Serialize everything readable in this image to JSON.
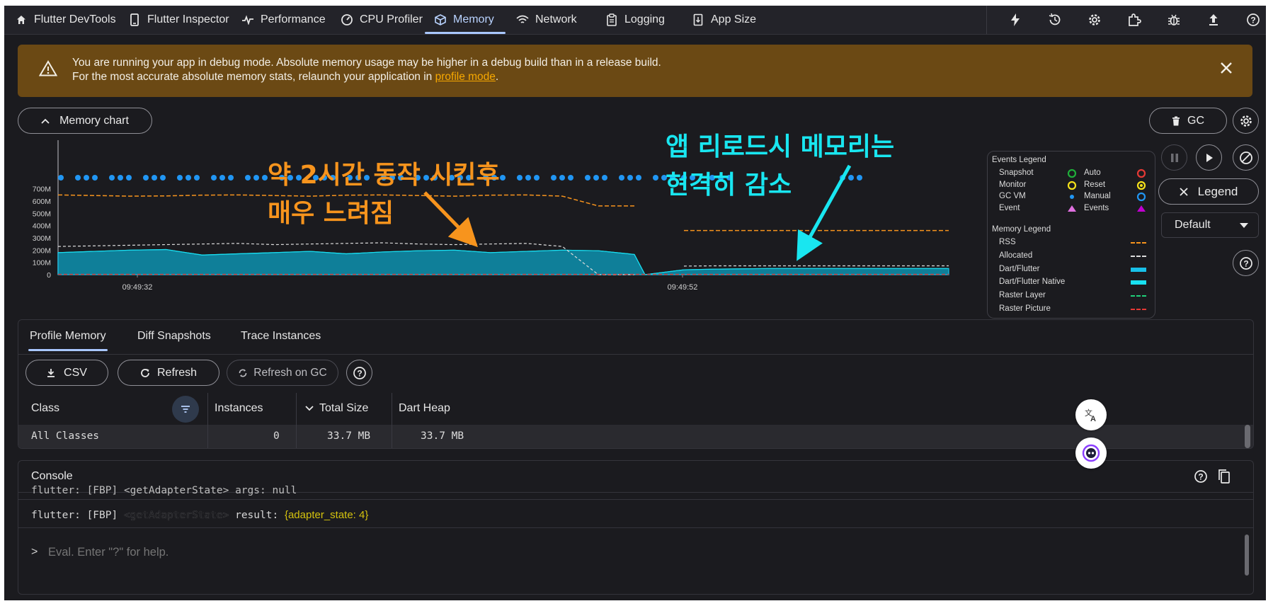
{
  "nav": {
    "tabs": [
      {
        "label": "Flutter DevTools",
        "icon": "home-icon"
      },
      {
        "label": "Flutter Inspector",
        "icon": "phone-icon"
      },
      {
        "label": "Performance",
        "icon": "pulse-icon"
      },
      {
        "label": "CPU Profiler",
        "icon": "gauge-icon"
      },
      {
        "label": "Memory",
        "icon": "cube-icon"
      },
      {
        "label": "Network",
        "icon": "wifi-icon"
      },
      {
        "label": "Logging",
        "icon": "clipboard-icon"
      },
      {
        "label": "App Size",
        "icon": "file-size-icon"
      }
    ],
    "active_tab": "Memory",
    "right_icons": [
      "lightning-icon",
      "history-icon",
      "gear-icon",
      "extension-icon",
      "bug-icon",
      "upload-icon",
      "help-icon"
    ]
  },
  "banner": {
    "line1": "You are running your app in debug mode. Absolute memory usage may be higher in a debug build than in a release build.",
    "line2_prefix": "For the most accurate absolute memory stats, relaunch your application in ",
    "line2_link": "profile mode",
    "line2_suffix": ".",
    "color": "#6b4914"
  },
  "chart_toolbar": {
    "memory_chart_label": "Memory chart",
    "gc_label": "GC",
    "legend_label": "Legend",
    "default_label": "Default"
  },
  "annotations": {
    "left_line1": "약 2시간 동작 시킨후",
    "left_line2": "매우 느려짐",
    "left_color": "#f7941d",
    "right_line1": "앱 리로드시 메모리는",
    "right_line2": "현격히 감소",
    "right_color": "#19e6f0"
  },
  "legend": {
    "events_title": "Events Legend",
    "events": [
      {
        "label": "Snapshot",
        "color": "#1fae3a"
      },
      {
        "label": "Auto",
        "color": "#e53935"
      },
      {
        "label": "Monitor",
        "color": "#f5e11a"
      },
      {
        "label": "Reset",
        "color": "#f5e11a"
      },
      {
        "label": "GC VM",
        "color": "#2196f3"
      },
      {
        "label": "Manual",
        "color": "#2196f3"
      },
      {
        "label": "Event",
        "color": "#e070e0"
      },
      {
        "label": "Events",
        "color": "#c000d0"
      }
    ],
    "memory_title": "Memory Legend",
    "memory": [
      {
        "label": "RSS",
        "color": "#f7941d"
      },
      {
        "label": "Allocated",
        "color": "#dcdcdc"
      },
      {
        "label": "Dart/Flutter",
        "color": "#18c0e8"
      },
      {
        "label": "Dart/Flutter Native",
        "color": "#18e0f0"
      },
      {
        "label": "Raster Layer",
        "color": "#1fd07a"
      },
      {
        "label": "Raster Picture",
        "color": "#e53935"
      }
    ]
  },
  "chart_data": {
    "type": "area",
    "y_ticks": [
      "700M",
      "600M",
      "500M",
      "400M",
      "300M",
      "200M",
      "100M",
      "0"
    ],
    "x_ticks": [
      "09:49:32",
      "09:49:52"
    ],
    "series": [
      {
        "name": "RSS",
        "values": [
          650,
          645,
          640,
          642,
          648,
          650,
          645,
          640,
          648,
          650,
          645,
          640,
          648,
          650,
          640,
          560,
          560,
          0,
          360,
          360,
          360,
          360,
          360,
          360,
          360,
          360,
          360,
          360
        ]
      },
      {
        "name": "Allocated",
        "values": [
          230,
          235,
          240,
          245,
          250,
          255,
          245,
          250,
          255,
          260,
          250,
          245,
          250,
          255,
          230,
          0,
          0,
          0,
          70,
          72,
          72,
          72,
          72,
          72,
          72,
          72,
          72,
          72
        ]
      },
      {
        "name": "Dart/Flutter",
        "values": [
          180,
          190,
          200,
          205,
          160,
          170,
          180,
          190,
          170,
          185,
          195,
          200,
          180,
          190,
          200,
          195,
          165,
          0,
          40,
          45,
          48,
          50,
          50,
          50,
          50,
          50,
          50,
          50
        ]
      },
      {
        "name": "Raster Picture",
        "values": [
          0,
          0,
          0,
          0,
          0,
          0,
          0,
          0,
          0,
          0,
          0,
          0,
          0,
          0,
          0,
          0,
          0,
          0,
          0,
          0,
          0,
          0,
          0,
          0,
          0,
          0,
          0,
          0
        ]
      }
    ],
    "ylim": [
      0,
      750
    ]
  },
  "profile": {
    "tabs": [
      "Profile Memory",
      "Diff Snapshots",
      "Trace Instances"
    ],
    "active_tab": "Profile Memory",
    "csv_label": "CSV",
    "refresh_label": "Refresh",
    "refresh_gc_label": "Refresh on GC",
    "columns": [
      "Class",
      "Instances",
      "Total Size",
      "Dart Heap"
    ],
    "rows": [
      {
        "class": "All Classes",
        "instances": "0",
        "total_size": "33.7 MB",
        "dart_heap": "33.7 MB"
      }
    ]
  },
  "console": {
    "title": "Console",
    "partial_line": "flutter: [FBP] <getAdapterState> args: null",
    "line_prefix": "flutter: [FBP] ",
    "line_tag": "<getAdapterState>",
    "line_mid": " result: ",
    "line_value": "{adapter_state: 4}",
    "prompt": ">",
    "input_placeholder": "Eval. Enter \"?\" for help."
  }
}
